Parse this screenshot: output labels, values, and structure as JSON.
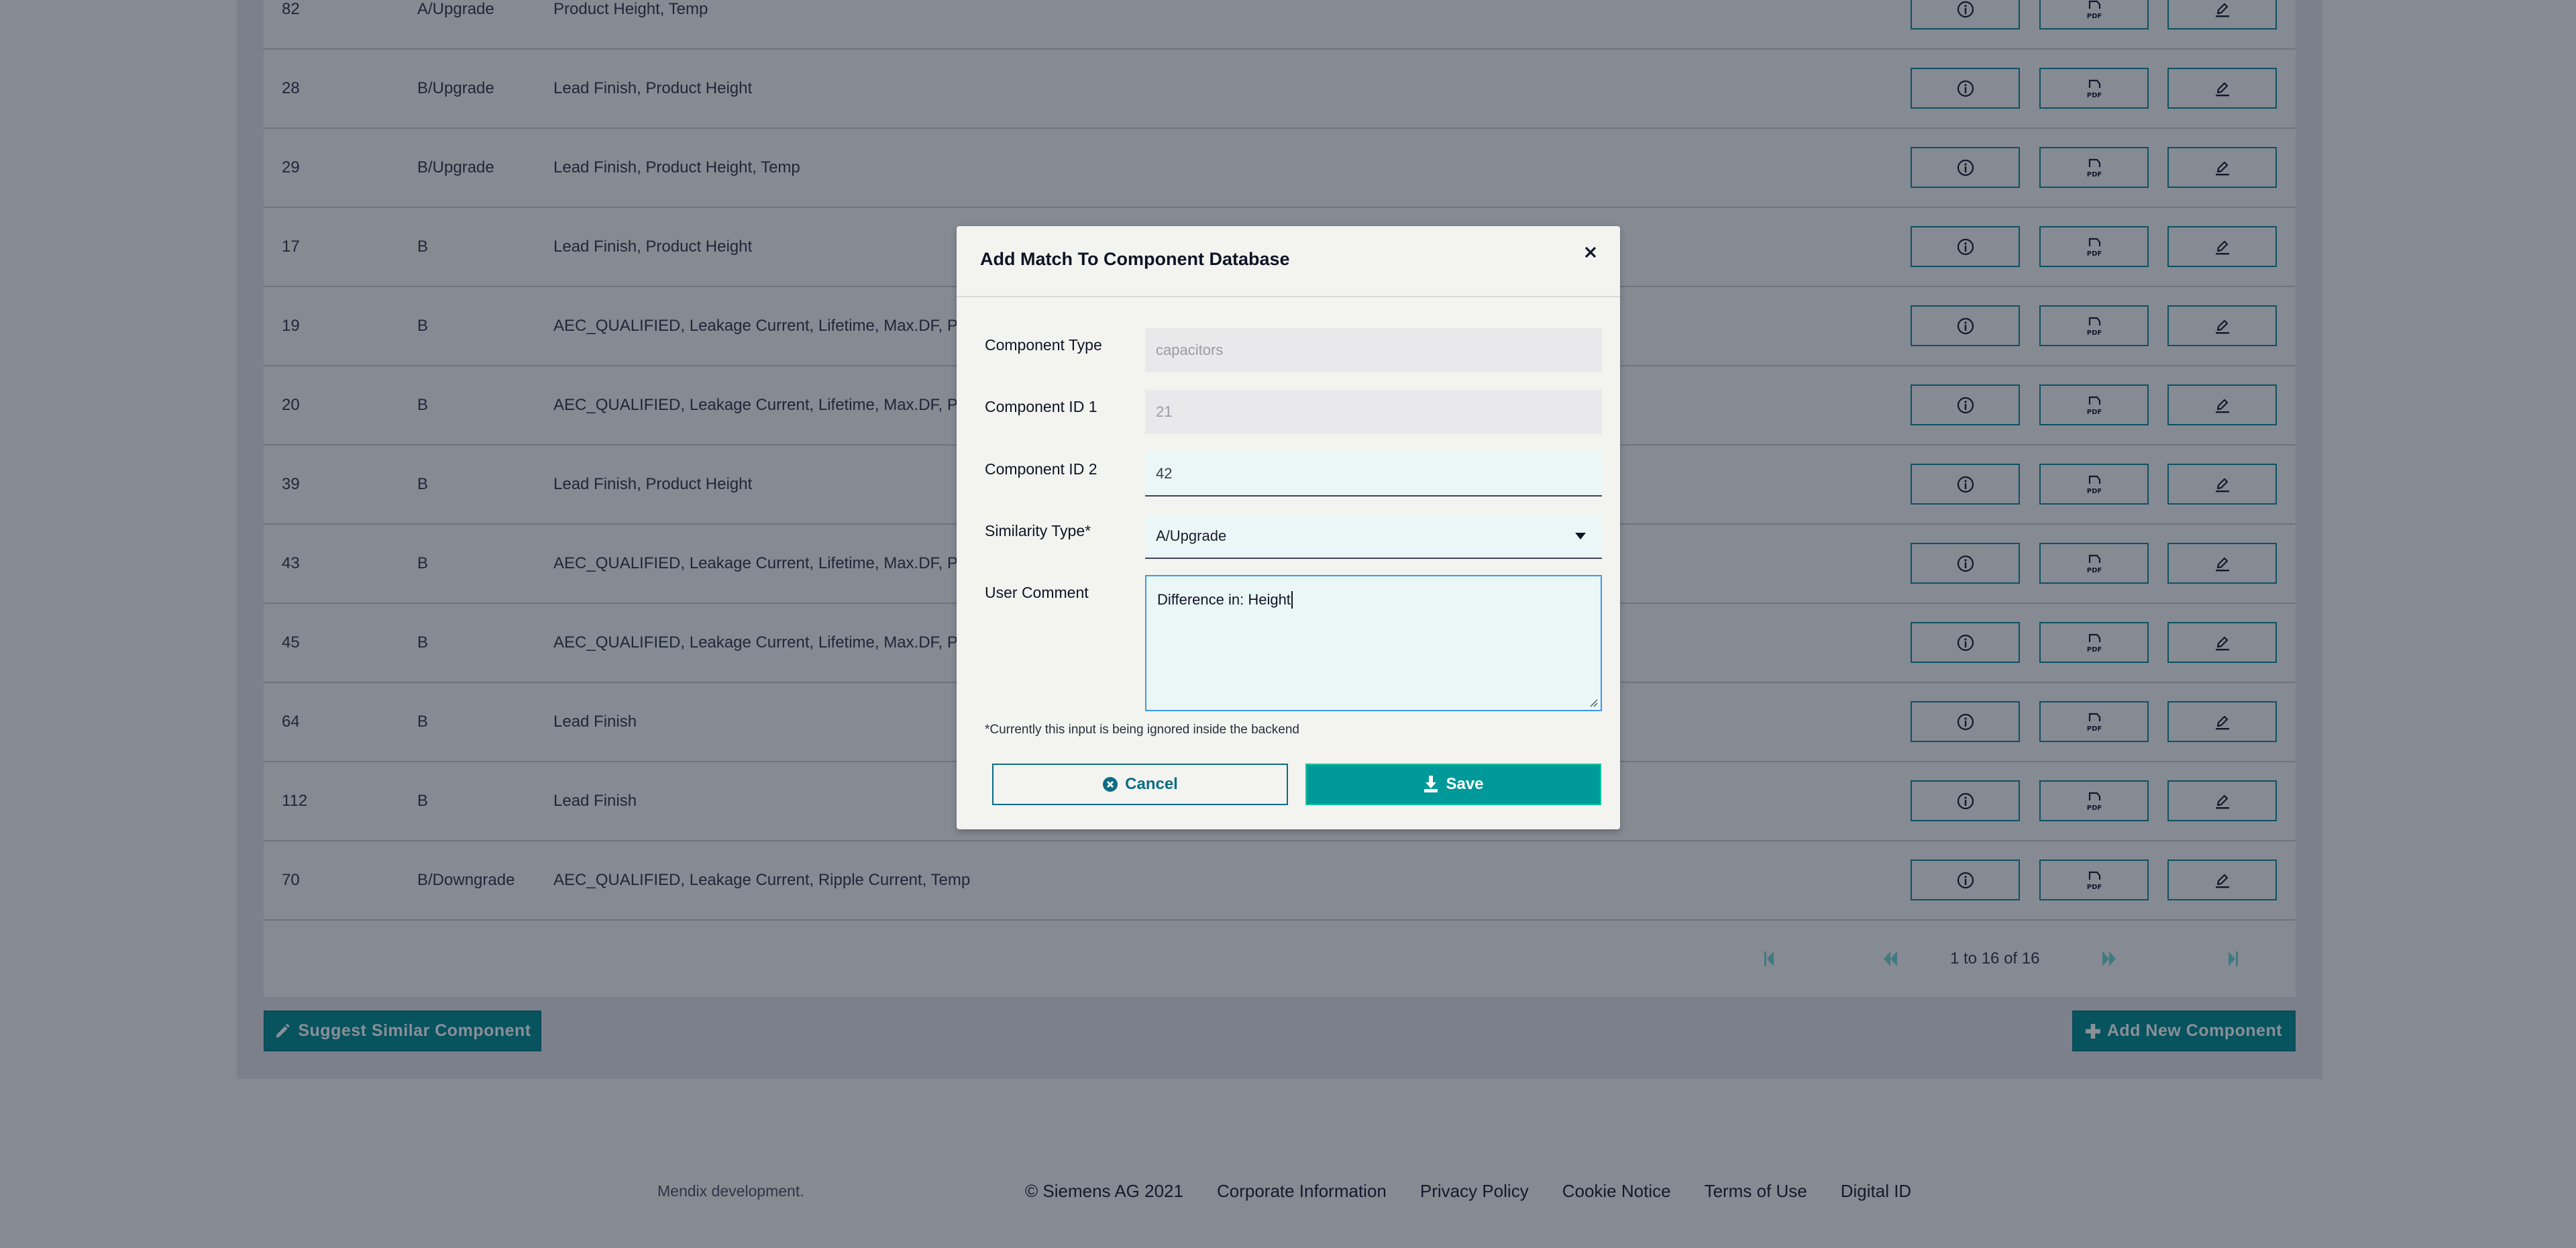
{
  "table": {
    "rows": [
      {
        "id": "82",
        "type": "A/Upgrade",
        "differences": "Product Height, Temp"
      },
      {
        "id": "28",
        "type": "B/Upgrade",
        "differences": "Lead Finish, Product Height"
      },
      {
        "id": "29",
        "type": "B/Upgrade",
        "differences": "Lead Finish, Product Height, Temp"
      },
      {
        "id": "17",
        "type": "B",
        "differences": "Lead Finish, Product Height"
      },
      {
        "id": "19",
        "type": "B",
        "differences": "AEC_QUALIFIED, Leakage Current, Lifetime, Max.DF, Produc"
      },
      {
        "id": "20",
        "type": "B",
        "differences": "AEC_QUALIFIED, Leakage Current, Lifetime, Max.DF, Produc"
      },
      {
        "id": "39",
        "type": "B",
        "differences": "Lead Finish, Product Height"
      },
      {
        "id": "43",
        "type": "B",
        "differences": "AEC_QUALIFIED, Leakage Current, Lifetime, Max.DF, Produc"
      },
      {
        "id": "45",
        "type": "B",
        "differences": "AEC_QUALIFIED, Leakage Current, Lifetime, Max.DF, Produc"
      },
      {
        "id": "64",
        "type": "B",
        "differences": "Lead Finish"
      },
      {
        "id": "112",
        "type": "B",
        "differences": "Lead Finish"
      },
      {
        "id": "70",
        "type": "B/Downgrade",
        "differences": "AEC_QUALIFIED, Leakage Current, Ripple Current, Temp"
      }
    ],
    "row_actions": [
      "info-icon",
      "pdf-icon",
      "edit-icon"
    ],
    "pagination": {
      "text": "1 to 16 of 16",
      "icons": [
        "first-page-icon",
        "previous-page-icon",
        "next-page-icon",
        "last-page-icon"
      ]
    }
  },
  "actions": {
    "suggest_label": "Suggest Similar Component",
    "add_label": "Add New Component"
  },
  "footer": {
    "mendix": "Mendix development.",
    "links": [
      "© Siemens AG 2021",
      "Corporate Information",
      "Privacy Policy",
      "Cookie Notice",
      "Terms of Use",
      "Digital ID"
    ]
  },
  "dialog": {
    "title": "Add Match To Component Database",
    "close_icon": "close-icon",
    "fields": {
      "component_type": {
        "label": "Component Type",
        "value": "capacitors"
      },
      "component_id1": {
        "label": "Component ID 1",
        "value": "21"
      },
      "component_id2": {
        "label": "Component ID 2",
        "value": "42"
      },
      "similarity_type": {
        "label": "Similarity Type*",
        "value": "A/Upgrade"
      },
      "user_comment": {
        "label": "User Comment",
        "value": "Difference in: Height"
      }
    },
    "note": "*Currently this input is being ignored inside the backend",
    "cancel_label": "Cancel",
    "save_label": "Save"
  },
  "colors": {
    "accent": "#009999",
    "dark_teal": "#07535e",
    "overlay_bg": "#868a93",
    "dialog_bg": "#f3f3f0"
  }
}
